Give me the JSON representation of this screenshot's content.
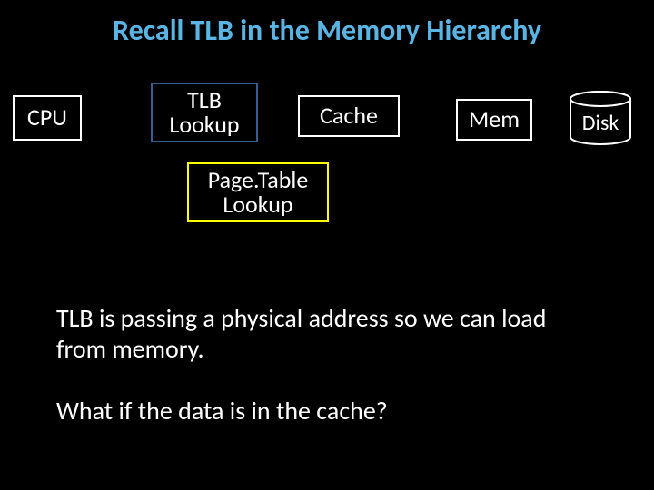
{
  "title": "Recall TLB in the Memory Hierarchy",
  "boxes": {
    "cpu": "CPU",
    "tlb": "TLB\nLookup",
    "cache": "Cache",
    "mem": "Mem",
    "pagetable": "Page.Table\nLookup",
    "disk": "Disk"
  },
  "para1": "TLB is passing a physical address so we can load from memory.",
  "para2": "What if the data is in the cache?"
}
